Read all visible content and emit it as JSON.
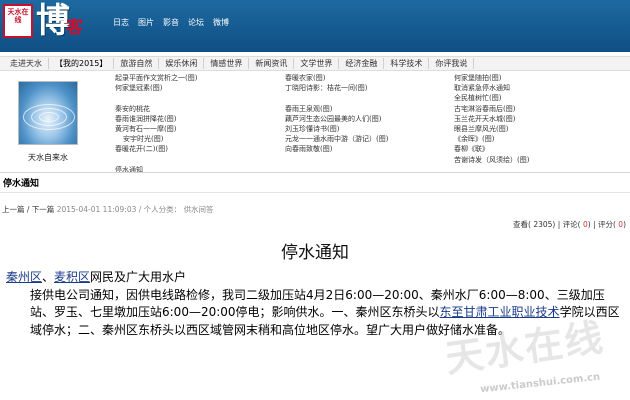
{
  "header": {
    "logo_seal_text": "天水在线",
    "logo_main": "博",
    "logo_sub": "客",
    "nav": [
      "日志",
      "图片",
      "影音",
      "论坛",
      "微博"
    ]
  },
  "navbar": {
    "items": [
      "走进天水",
      "【我的2015】",
      "旅游自然",
      "娱乐休闲",
      "情感世界",
      "新闻资讯",
      "文学世界",
      "经济金融",
      "科学技术",
      "你评我说"
    ]
  },
  "profile": {
    "caption": "天水自来水"
  },
  "blog_columns": {
    "col1": [
      "起录平面作文赏析之一(图)",
      "何家堡冠素(图)",
      "",
      "",
      "秦安的桃花",
      "春雨谁润拼降花(图)",
      "黄河有石一一摩(图)",
      "安宇时光(图)",
      "春暖花开(二)(图)",
      "",
      "停水通知"
    ],
    "col2": [
      "春暖农家(图)",
      "丁晓阳诗影：桔花一间(图)",
      "",
      "",
      "春雨王泉观(图)",
      "藕芦河生态公园最美的人们(图)",
      "刘玉珍懂诗书(图)",
      "元龙一一通水雨中游（游记）(图)",
      "向春雨致敬(图)"
    ],
    "col3": [
      "何家堡随拍(图)",
      "取消紧急停水通知",
      "全民植树忙(图)",
      "古宅淋浴春雨后(图)",
      "玉兰花开天水城(图)",
      "眼县兰摩风光(图)",
      "《余晖》(图)",
      "春柳《联》",
      "苦谢诗发（风须绘）(图)"
    ]
  },
  "section": {
    "title": "停水通知"
  },
  "meta": {
    "prev": "上一篇",
    "next": "下一篇",
    "datetime": "2015-04-01 11:09:03",
    "category_label": "个人分类：",
    "category": "供水间答"
  },
  "stats": {
    "views_label": "查看",
    "views": "2305",
    "comments_label": "评论",
    "comments": "0",
    "rating_label": "评分",
    "rating": "0"
  },
  "article": {
    "title": "停水通知",
    "link1": "秦州区",
    "sep1": "、",
    "link2": "麦积区",
    "line1_rest": "网民及广大用水户",
    "body1": "接供电公司通知，因供电线路检修，我司二级加压站4月2日6:00—20:00、秦州水厂6:00—8:00、三级加压站、罗玉、七里墩加压站6:00—20:00停电；影响供水。一、秦州区东桥头以",
    "link3": "东至甘肃工业职业技术",
    "body2": "学院以西区域停水；二、秦州区东桥头以西区域管网末稍和高位地区停水。望广大用户做好储水准备。"
  },
  "watermark": {
    "text": "天水在线",
    "url": "www.tianshui.com.cn"
  }
}
